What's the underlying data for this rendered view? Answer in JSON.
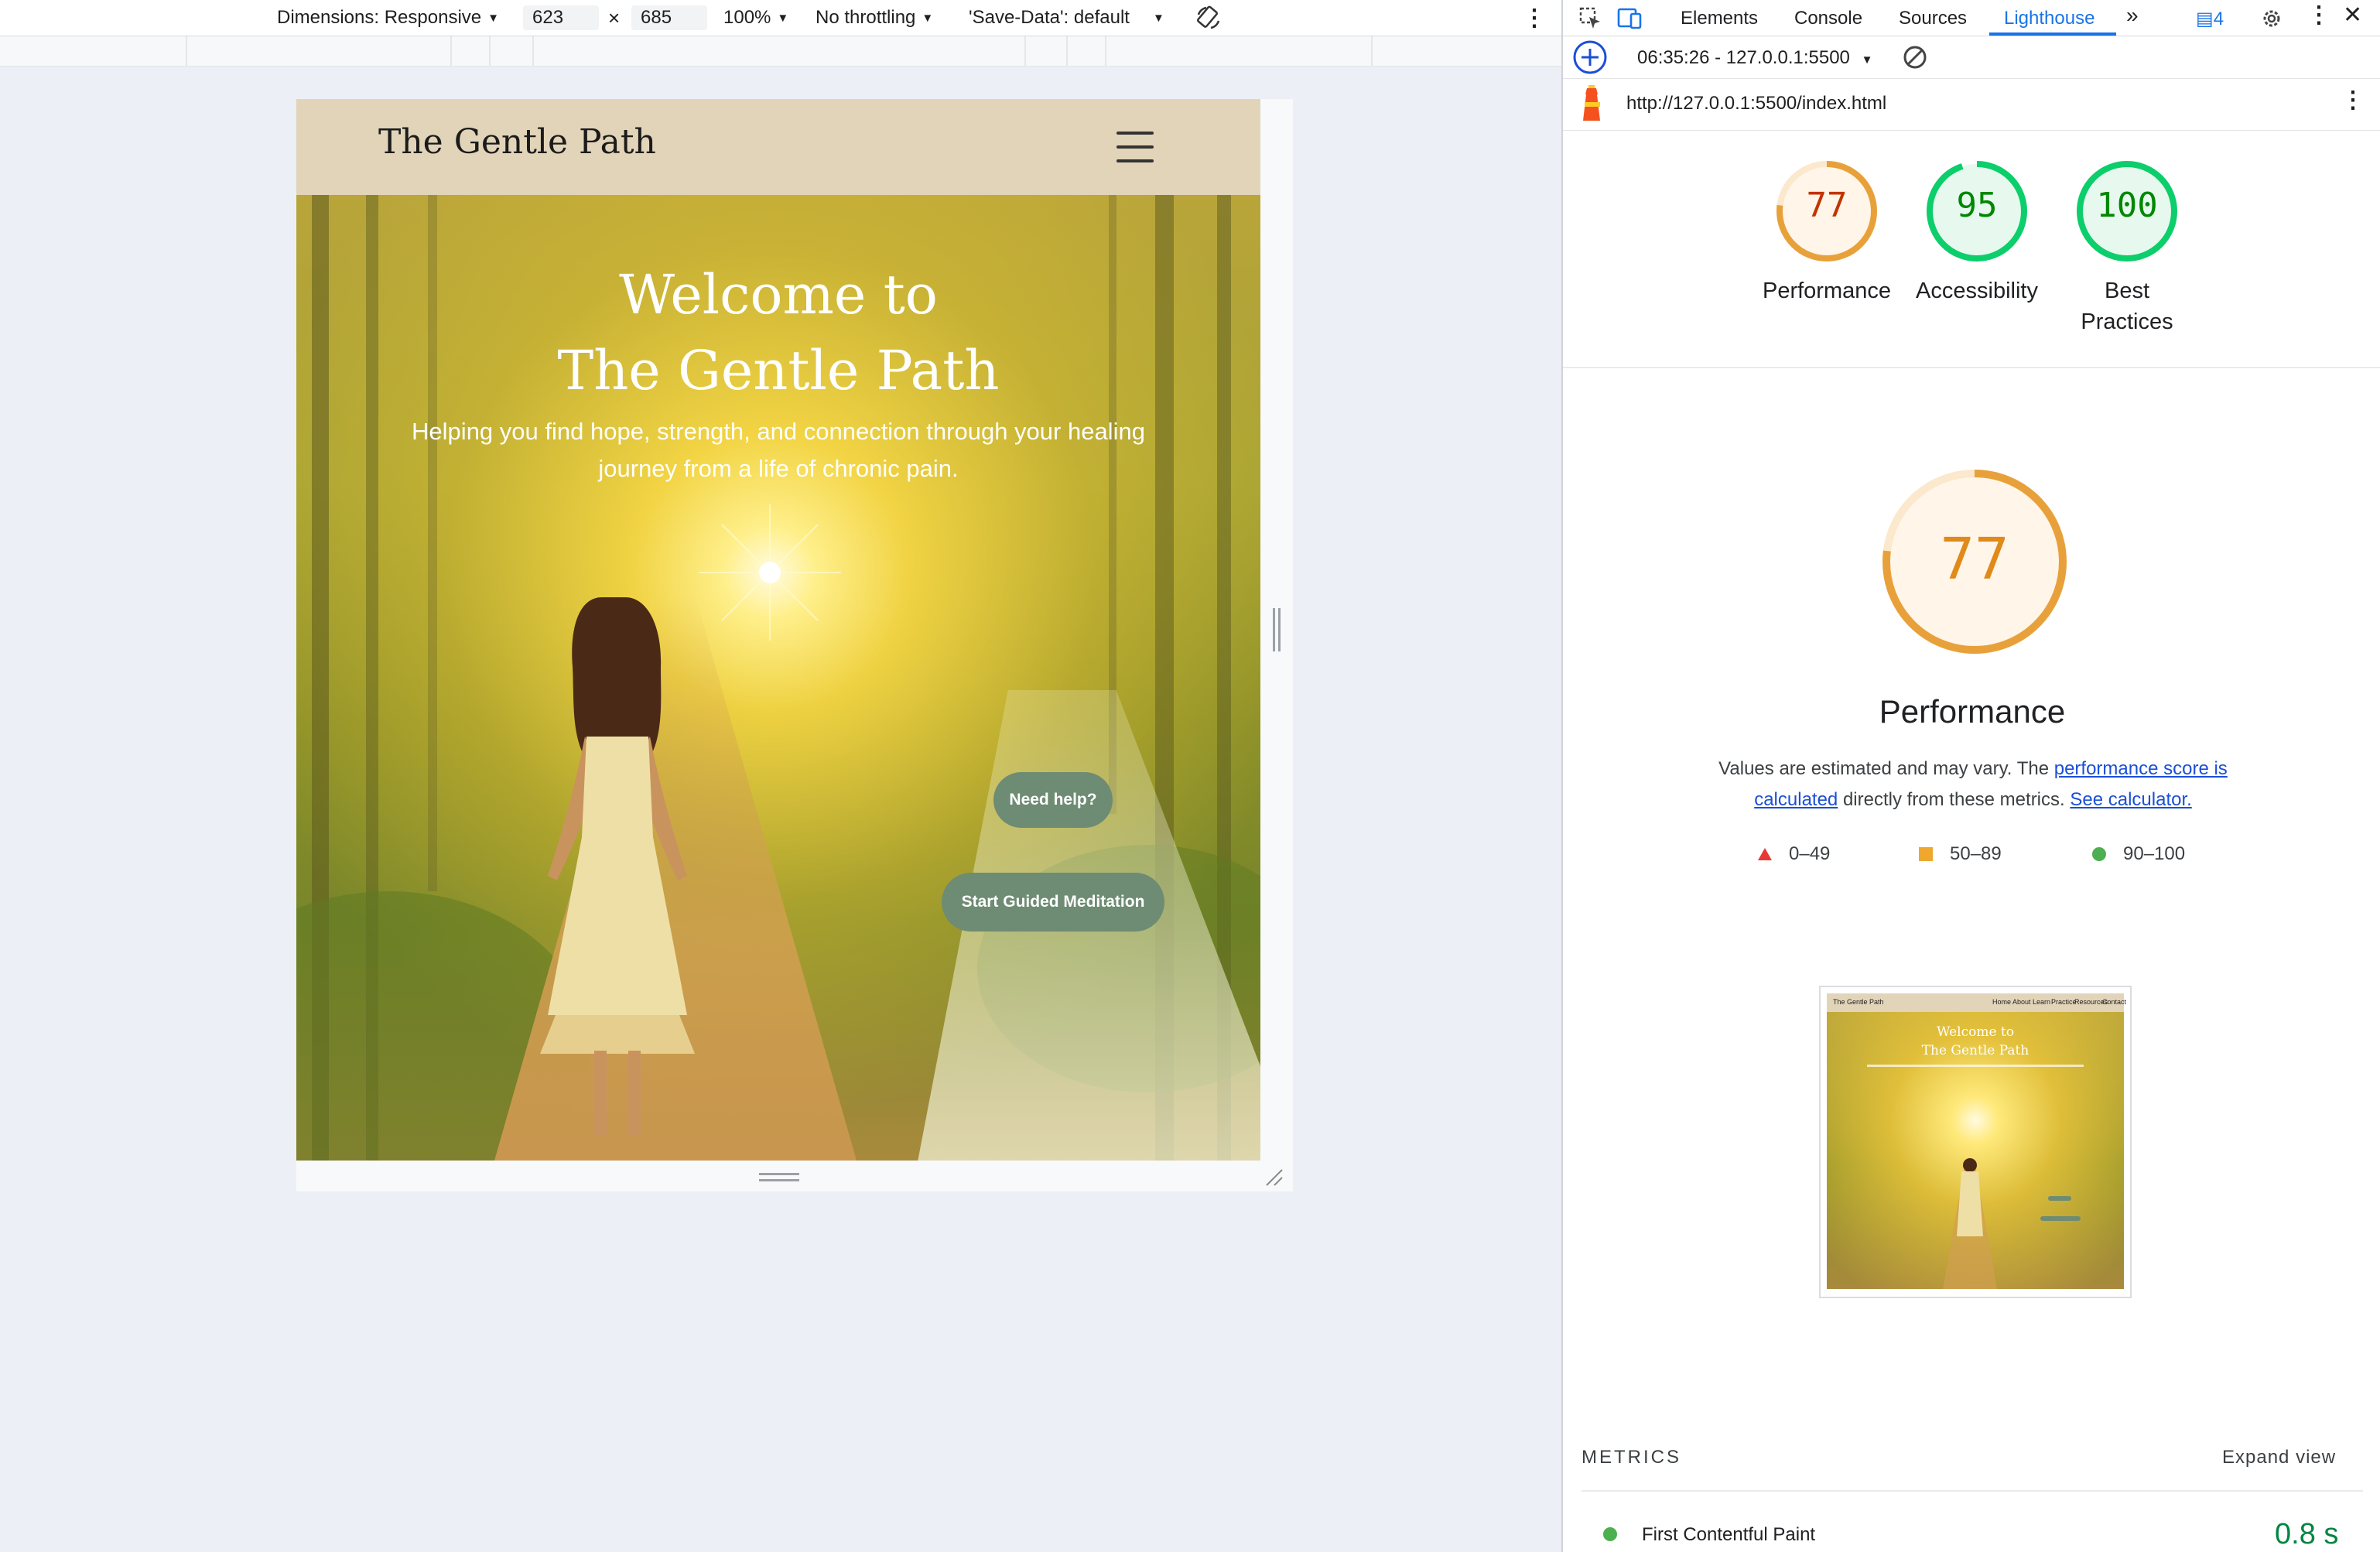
{
  "device_toolbar": {
    "dimensions_label": "Dimensions: Responsive",
    "width_value": "623",
    "times": "×",
    "height_value": "685",
    "zoom": "100%",
    "throttling": "No throttling",
    "save_data": "'Save-Data': default"
  },
  "site": {
    "title": "The Gentle Path",
    "hero_heading_line1": "Welcome to",
    "hero_heading_line2": "The Gentle Path",
    "hero_subtitle": "Helping you find hope, strength, and connection through your healing journey from a life of chronic pain.",
    "need_help_label": "Need help?",
    "start_meditation_label": "Start Guided Meditation"
  },
  "devtools": {
    "tabs": [
      "Elements",
      "Console",
      "Sources",
      "Lighthouse"
    ],
    "active_tab": "Lighthouse",
    "issues_count": "4",
    "report_time": "06:35:26 - 127.0.0.1:5500",
    "url": "http://127.0.0.1:5500/index.html",
    "scores": [
      {
        "label": "Performance",
        "score": 77,
        "color": "#e8a13a",
        "text_color": "#c33300"
      },
      {
        "label": "Accessibility",
        "score": 95,
        "color": "#0cce6b",
        "text_color": "#008800"
      },
      {
        "label_line1": "Best",
        "label_line2": "Practices",
        "score": 100,
        "color": "#0cce6b",
        "text_color": "#008800"
      }
    ],
    "big_gauge": {
      "score": 77,
      "title": "Performance",
      "color": "#e8a13a",
      "text_color": "#e08a1a"
    },
    "description_prefix": "Values are estimated and may vary. The ",
    "description_link1": "performance score is calculated",
    "description_middle": " directly from these metrics. ",
    "description_link2": "See calculator.",
    "legend": [
      {
        "range": "0–49",
        "shape": "triangle",
        "color": "#e53935"
      },
      {
        "range": "50–89",
        "shape": "square",
        "color": "#f0a72e"
      },
      {
        "range": "90–100",
        "shape": "circle",
        "color": "#4caf50"
      }
    ],
    "thumbnail": {
      "site_title": "The Gentle Path",
      "nav_items": [
        "Home",
        "About",
        "Learn",
        "Practice",
        "Resources",
        "Contact"
      ],
      "heading_line1": "Welcome to",
      "heading_line2": "The Gentle Path"
    },
    "metrics_label": "METRICS",
    "expand_view": "Expand view",
    "metrics": [
      {
        "name": "First Contentful Paint",
        "value": "0.8 s",
        "color": "#0cce6b"
      }
    ]
  }
}
